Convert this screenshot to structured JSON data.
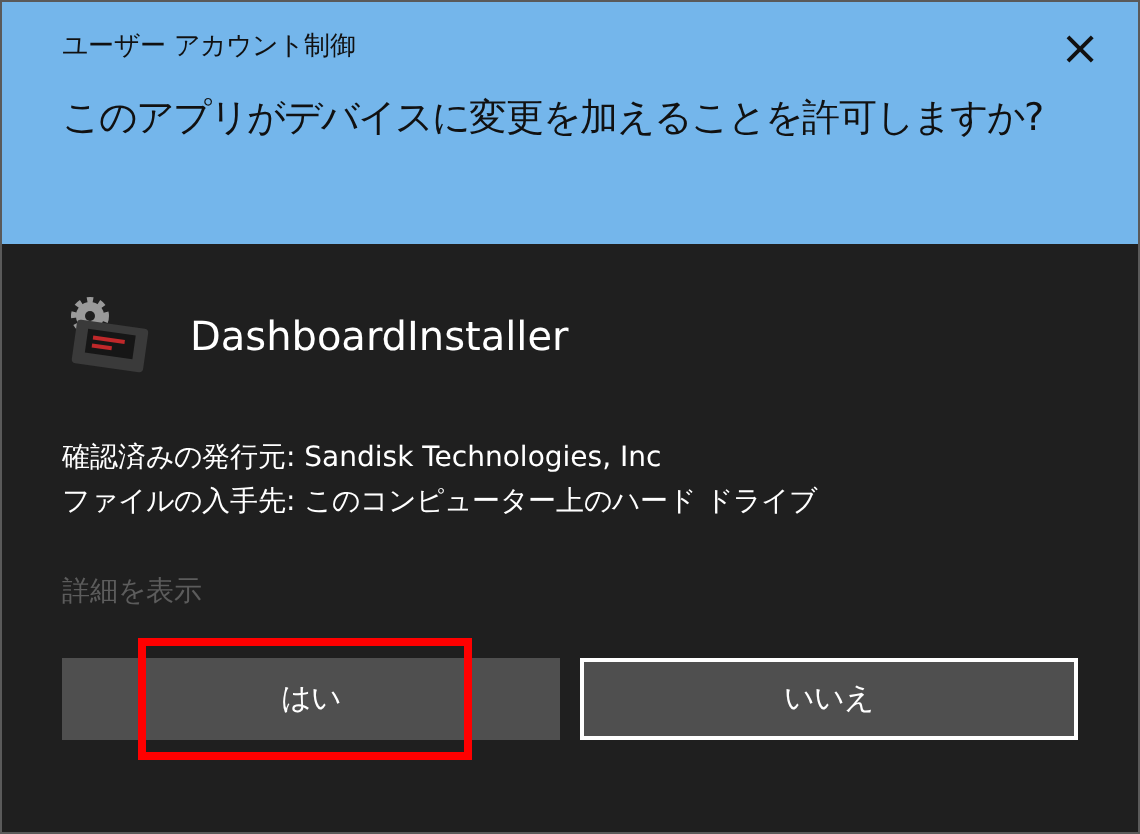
{
  "window": {
    "title": "ユーザー アカウント制御",
    "close": "×"
  },
  "question": "このアプリがデバイスに変更を加えることを許可しますか?",
  "app": {
    "name": "DashboardInstaller"
  },
  "details": [
    "確認済みの発行元: Sandisk Technologies, Inc",
    "ファイルの入手先: このコンピューター上のハード ドライブ"
  ],
  "more_details": {
    "label": "詳細を表示",
    "disabled": true
  },
  "buttons": [
    {
      "label": "はい",
      "focused": false,
      "highlighted": true
    },
    {
      "label": "いいえ",
      "focused": true,
      "highlighted": false
    }
  ]
}
